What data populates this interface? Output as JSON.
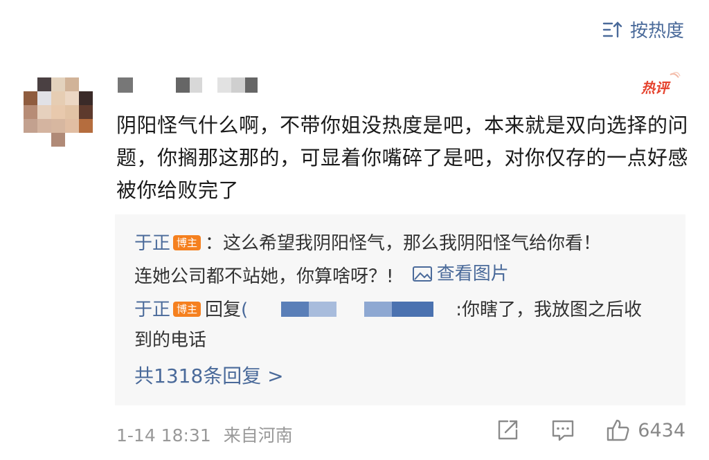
{
  "sort": {
    "label": "按热度"
  },
  "comment": {
    "hot_badge": "热评",
    "text": "阴阳怪气什么啊，不带你姐没热度是吧，本来就是双向选择的问题，你搁那这那的，可显着你嘴碎了是吧，对你仅存的一点好感被你给败完了",
    "timestamp": "1-14 18:31",
    "location": "来自河南",
    "likes": "6434"
  },
  "replies": {
    "items": [
      {
        "user": "于正",
        "tag": "博主",
        "separator": "：",
        "line1": "这么希望我阴阳怪气，那么我阴阳怪气给你看！",
        "line2": "连她公司都不站她，你算啥呀？!",
        "link": "查看图片"
      },
      {
        "user": "于正",
        "tag": "博主",
        "reply_word": "回复",
        "paren": "(",
        "line1_tail": ":你瞎了，我放图之后收",
        "line2": "到的电话"
      }
    ],
    "view_all": "共1318条回复 >"
  },
  "colors": {
    "link": "#4a6a9a",
    "badge": "#f5801f",
    "hot": "#e5432e",
    "reply_bg": "#f7f7f7",
    "meta": "#999999"
  },
  "icons": [
    "sort-icon",
    "image-icon",
    "share-icon",
    "comment-icon",
    "like-icon"
  ]
}
